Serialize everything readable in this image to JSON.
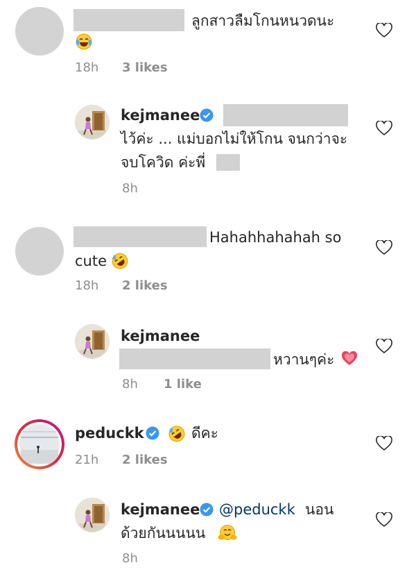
{
  "comments": [
    {
      "text": "ลูกสาวลืมโกนหนวดนะ",
      "emoji": "tears-of-joy-emoji",
      "time": "18h",
      "likes": "3 likes",
      "reply": {
        "username": "kejmanee",
        "line1": "ไว้ค่ะ ... แม่บอกไม่ให้โกน จนกว่าจะ",
        "line2": "จบโควิด ค่ะพี่",
        "time": "8h"
      }
    },
    {
      "text": "Hahahhahahah so",
      "text2": "cute",
      "emoji": "rolling-laughing-emoji",
      "time": "18h",
      "likes": "2 likes",
      "reply": {
        "username": "kejmanee",
        "text": "หวานๆค่ะ",
        "emoji": "sparkling-heart-emoji",
        "time": "8h",
        "likes": "1 like"
      }
    },
    {
      "username": "peduckk",
      "text": "ดีคะ",
      "emoji": "rolling-laughing-emoji",
      "time": "21h",
      "likes": "2 likes",
      "reply": {
        "username": "kejmanee",
        "mention": "@peduckk",
        "line1": "นอน",
        "line2": "ด้วยกันนนนน",
        "emoji": "hugging-face-emoji",
        "time": "8h"
      }
    }
  ],
  "colors": {
    "text": "#262626",
    "meta": "#8e8e8e",
    "verified": "#3897f0",
    "mention": "#00376b",
    "story_ring": [
      "#f09433",
      "#dc2743",
      "#bc1888"
    ]
  }
}
